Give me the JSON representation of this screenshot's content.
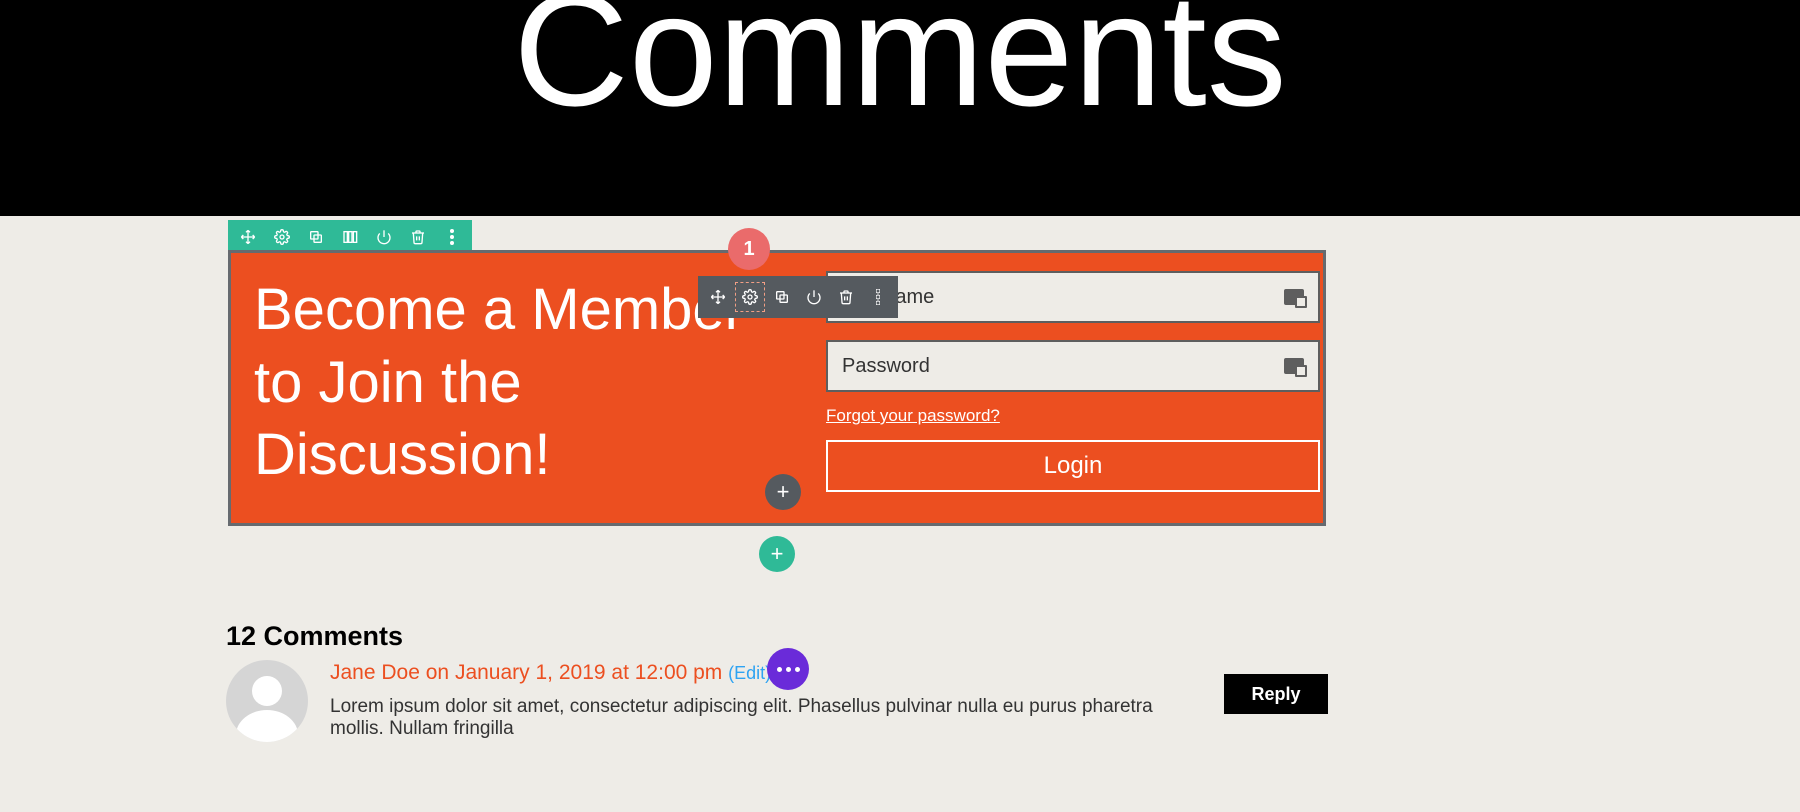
{
  "hero": {
    "title": "Comments"
  },
  "row_toolbar": {
    "badge": "1"
  },
  "membership": {
    "headline": "Become a Member to Join the Discussion!",
    "username_placeholder": "Username",
    "password_placeholder": "Password",
    "forgot_link": "Forgot your password?",
    "login_label": "Login"
  },
  "comments": {
    "heading": "12 Comments",
    "items": [
      {
        "author": "Jane Doe",
        "on": "on",
        "date": "January 1, 2019 at 12:00 pm",
        "edit": "(Edit)",
        "body": "Lorem ipsum dolor sit amet, consectetur adipiscing elit. Phasellus pulvinar nulla eu purus pharetra mollis. Nullam fringilla",
        "reply": "Reply"
      }
    ]
  },
  "colors": {
    "primary": "#ec4f20",
    "teal": "#2fba97",
    "gray": "#555a5f",
    "purple": "#6a2bd9"
  }
}
